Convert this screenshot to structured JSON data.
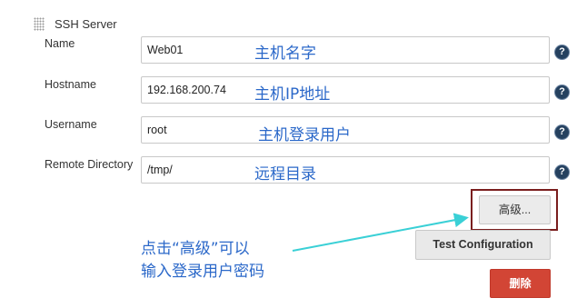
{
  "section": {
    "title": "SSH Server"
  },
  "fields": [
    {
      "label": "Name",
      "value": "Web01",
      "annotation": "主机名字"
    },
    {
      "label": "Hostname",
      "value": "192.168.200.74",
      "annotation": "主机IP地址"
    },
    {
      "label": "Username",
      "value": "root",
      "annotation": "主机登录用户"
    },
    {
      "label": "Remote Directory",
      "value": "/tmp/",
      "annotation": "远程目录"
    }
  ],
  "help_icon_glyph": "?",
  "buttons": {
    "advanced": "高级...",
    "test_configuration": "Test Configuration",
    "delete": "删除"
  },
  "callout": {
    "line1": "点击“高级”可以",
    "line2": "输入登录用户密码"
  },
  "colors": {
    "annotation": "#2b68c9",
    "highlight_box": "#7a1e1e",
    "arrow": "#3ad0d6",
    "delete_button": "#d24535",
    "help_icon": "#25415f"
  }
}
